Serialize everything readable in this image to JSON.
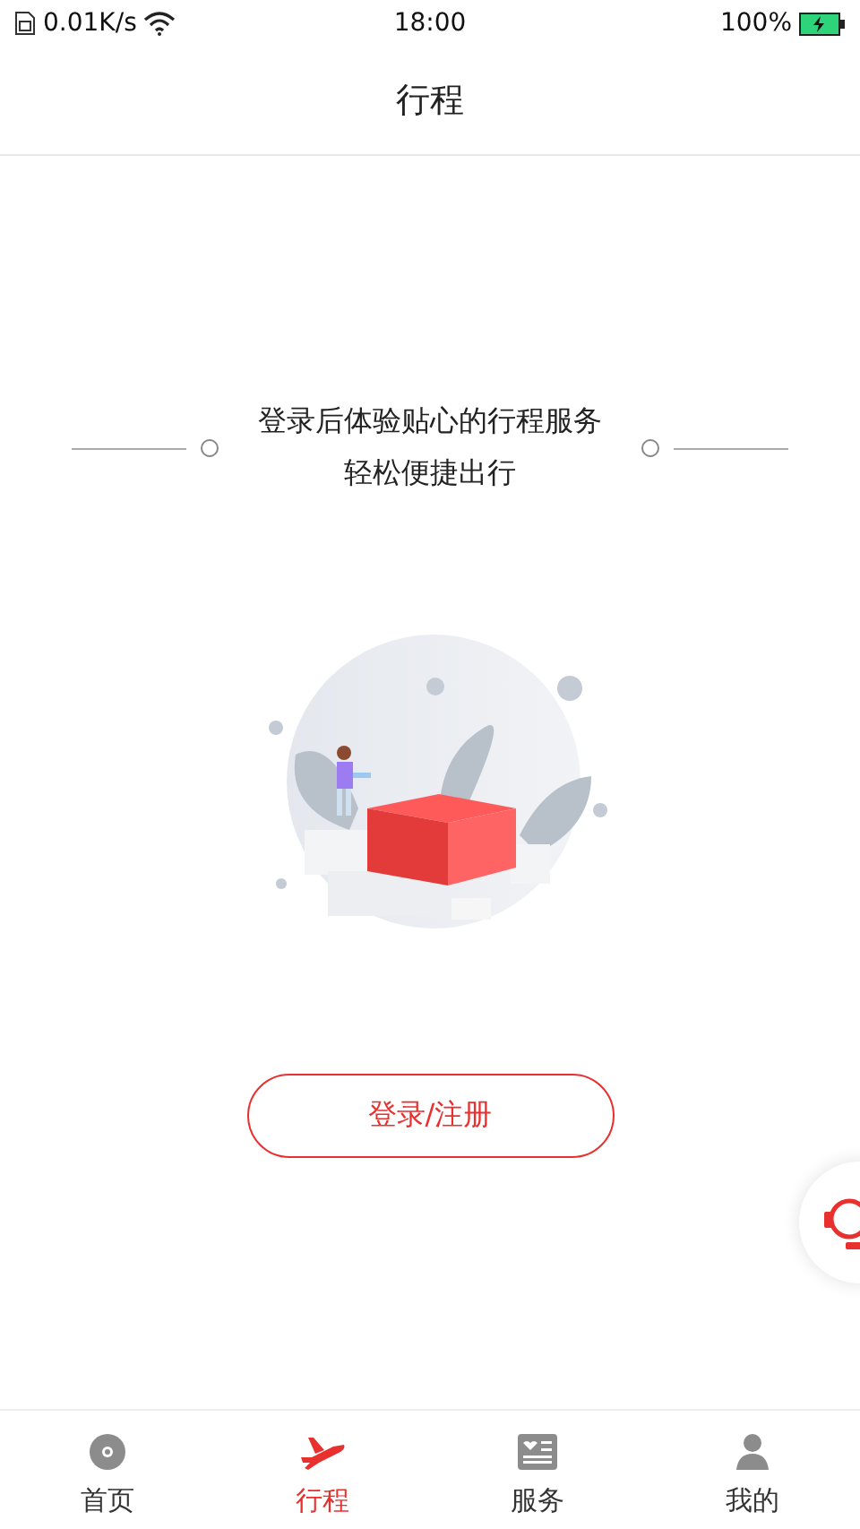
{
  "status_bar": {
    "speed": "0.01K/s",
    "time": "18:00",
    "battery": "100%"
  },
  "header": {
    "title": "行程"
  },
  "prompt": {
    "lines": [
      "登录后体验贴心的行程服务",
      "轻松便捷出行"
    ]
  },
  "login_button": "登录/注册",
  "tabs": [
    {
      "label": "首页",
      "selected": false
    },
    {
      "label": "行程",
      "selected": true
    },
    {
      "label": "服务",
      "selected": false
    },
    {
      "label": "我的",
      "selected": false
    }
  ]
}
